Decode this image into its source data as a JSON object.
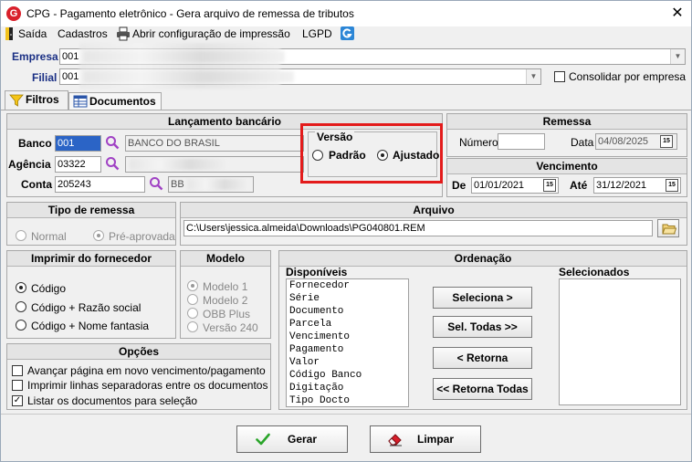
{
  "window": {
    "title": "CPG - Pagamento eletrônico - Gera arquivo de remessa de tributos",
    "logo_letter": "G",
    "close_glyph": "✕"
  },
  "menu": {
    "saida": "Saída",
    "cadastros": "Cadastros",
    "abrir_config": "Abrir configuração de impressão",
    "lgpd": "LGPD"
  },
  "header": {
    "empresa_label": "Empresa",
    "empresa_code": "001",
    "filial_label": "Filial",
    "filial_code": "001",
    "consolidar_label": "Consolidar por empresa"
  },
  "tabs": [
    {
      "label": "Filtros"
    },
    {
      "label": "Documentos"
    }
  ],
  "lancamento": {
    "title": "Lançamento bancário",
    "banco_label": "Banco",
    "banco_code": "001",
    "banco_name": "BANCO DO BRASIL",
    "agencia_label": "Agência",
    "agencia_value": "03322",
    "conta_label": "Conta",
    "conta_value": "205243",
    "conta_desc_prefix": "BB"
  },
  "versao": {
    "title": "Versão",
    "padrao": "Padrão",
    "ajustado": "Ajustado"
  },
  "remessa": {
    "title": "Remessa",
    "numero_label": "Número",
    "numero_value": "",
    "data_label": "Data",
    "data_value": "04/08/2025"
  },
  "vencimento": {
    "title": "Vencimento",
    "de_label": "De",
    "de_value": "01/01/2021",
    "ate_label": "Até",
    "ate_value": "31/12/2021"
  },
  "tipo_remessa": {
    "title": "Tipo de remessa",
    "normal": "Normal",
    "pre_aprovada": "Pré-aprovada"
  },
  "arquivo": {
    "title": "Arquivo",
    "path": "C:\\Users\\jessica.almeida\\Downloads\\PG040801.REM"
  },
  "imprimir": {
    "title": "Imprimir do fornecedor",
    "options": [
      "Código",
      "Código + Razão social",
      "Código + Nome fantasia"
    ]
  },
  "modelo": {
    "title": "Modelo",
    "options": [
      "Modelo 1",
      "Modelo 2",
      "OBB Plus",
      "Versão 240"
    ]
  },
  "opcoes": {
    "title": "Opções",
    "items": [
      {
        "label": "Avançar página em novo vencimento/pagamento",
        "checked": false
      },
      {
        "label": "Imprimir linhas separadoras entre os documentos",
        "checked": false
      },
      {
        "label": "Listar os documentos para seleção",
        "checked": true
      }
    ]
  },
  "ordenacao": {
    "title": "Ordenação",
    "disponiveis_label": "Disponíveis",
    "selecionados_label": "Selecionados",
    "disponiveis": [
      "Fornecedor",
      "Série",
      "Documento",
      "Parcela",
      "Vencimento",
      "Pagamento",
      "Valor",
      "Código Banco",
      "Digitação",
      "Tipo Docto"
    ],
    "btn_seleciona": "Seleciona >",
    "btn_sel_todas": "Sel. Todas >>",
    "btn_retorna": "< Retorna",
    "btn_retorna_todas": "<< Retorna Todas"
  },
  "footer": {
    "gerar": "Gerar",
    "limpar": "Limpar"
  },
  "colors": {
    "navy_label": "#1a2f84",
    "highlight_box": "#e31b1b",
    "selection": "#2b64c6",
    "gerar_check": "#2aa52a",
    "limpar_eraser": "#d81e2a"
  }
}
